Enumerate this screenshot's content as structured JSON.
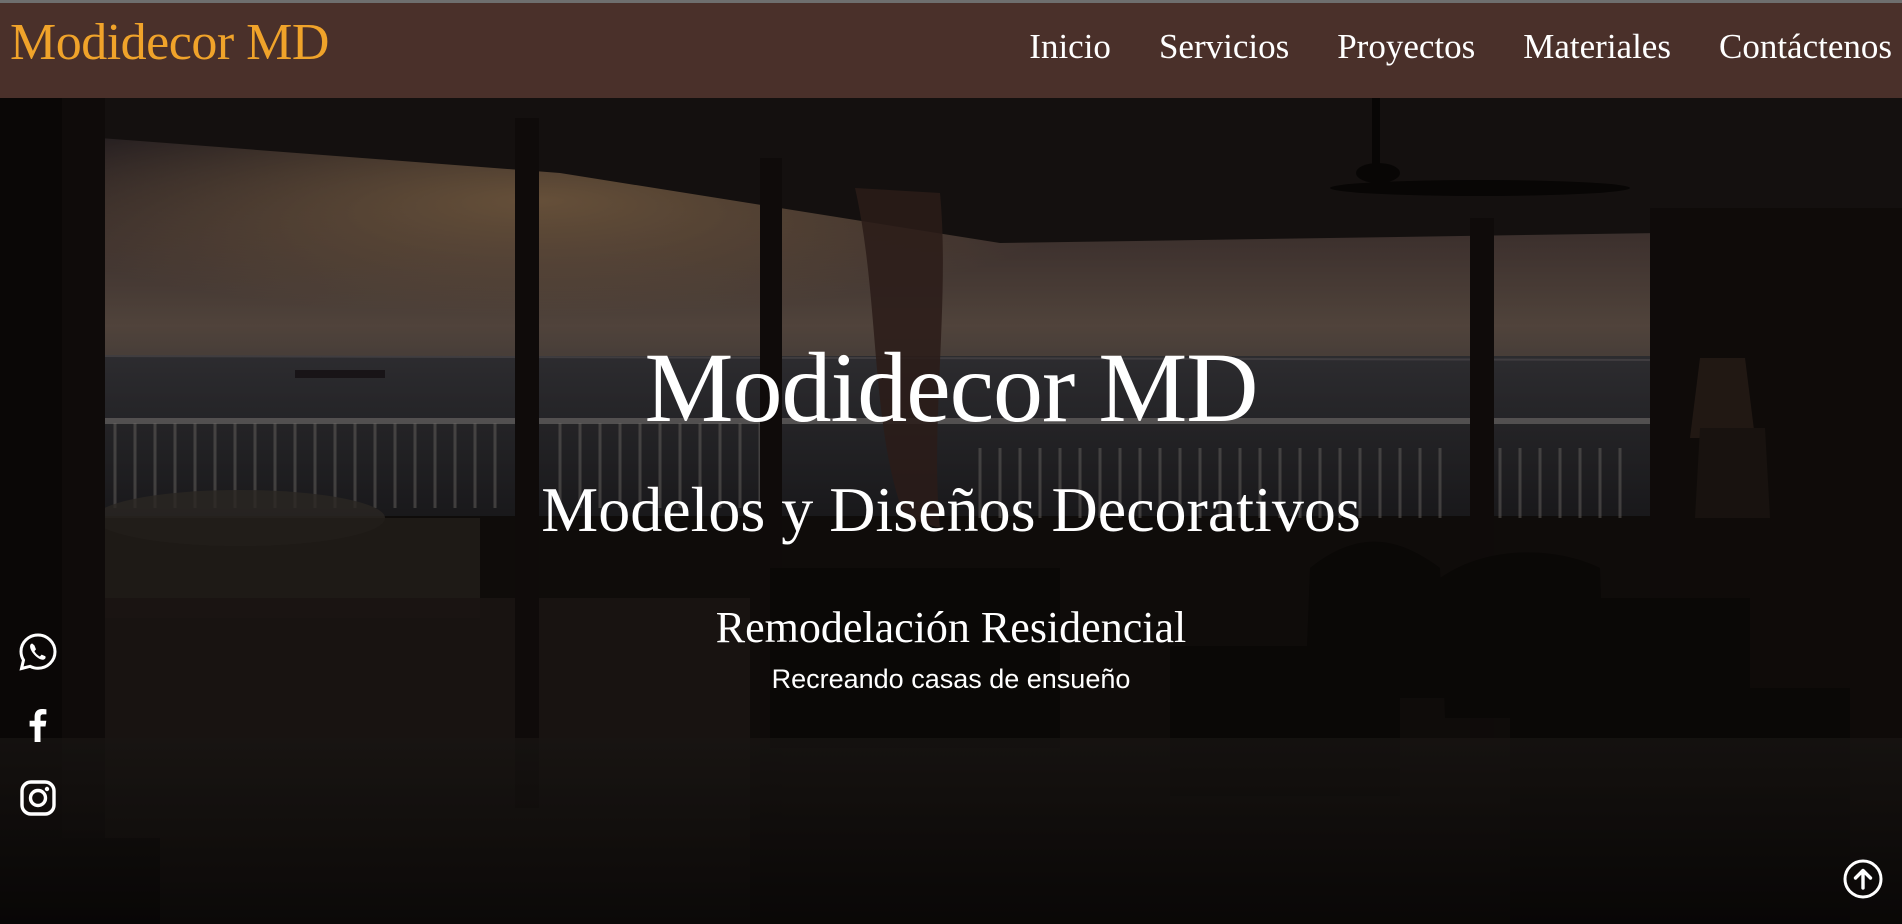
{
  "header": {
    "brand": "Modidecor MD",
    "nav": [
      {
        "label": "Inicio"
      },
      {
        "label": "Servicios"
      },
      {
        "label": "Proyectos"
      },
      {
        "label": "Materiales"
      },
      {
        "label": "Contáctenos"
      }
    ]
  },
  "hero": {
    "title": "Modidecor MD",
    "subtitle": "Modelos y Diseños Decorativos",
    "service": "Remodelación Residencial",
    "tagline": "Recreando casas de ensueño"
  },
  "social": {
    "icons": [
      "whatsapp-icon",
      "facebook-icon",
      "instagram-icon"
    ]
  },
  "scroll_top_icon": "arrow-up-circle-icon",
  "colors": {
    "header_bg": "#4a302a",
    "brand": "#f0a32a",
    "text": "#ffffff"
  }
}
